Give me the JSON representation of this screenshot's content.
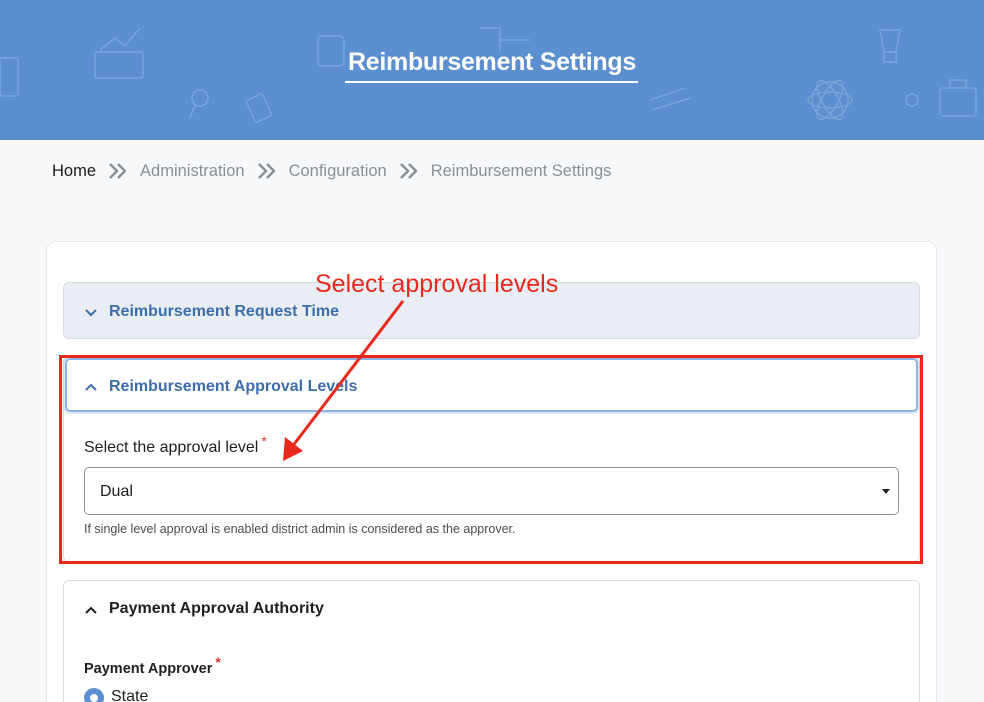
{
  "header": {
    "title": "Reimbursement Settings"
  },
  "breadcrumb": {
    "items": [
      "Home",
      "Administration",
      "Configuration",
      "Reimbursement Settings"
    ]
  },
  "sections": {
    "request_time": {
      "title": "Reimbursement Request Time",
      "expanded": false
    },
    "approval_levels": {
      "title": "Reimbursement Approval Levels",
      "expanded": true,
      "field_label": "Select the approval level",
      "required_mark": "*",
      "selected_value": "Dual",
      "help_text": "If single level approval is enabled district admin is considered as the approver."
    },
    "payment_authority": {
      "title": "Payment Approval Authority",
      "expanded": true,
      "field_label": "Payment Approver",
      "required_mark": "*",
      "options": [
        "State"
      ],
      "selected": "State"
    }
  },
  "annotation": {
    "text": "Select approval levels",
    "color": "#e8291c"
  },
  "colors": {
    "banner": "#5b8fd0",
    "accent_text": "#3e6ea9",
    "highlight": "#e8291c"
  }
}
